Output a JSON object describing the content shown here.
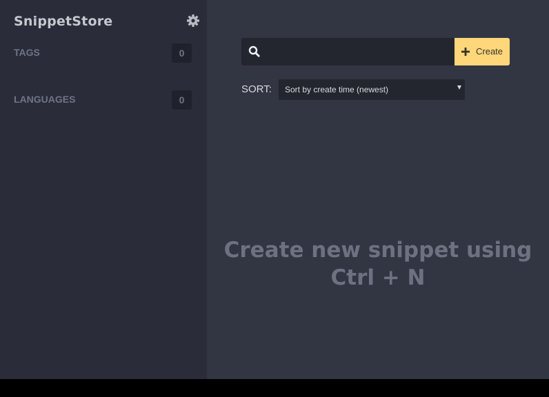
{
  "sidebar": {
    "app_title": "SnippetStore",
    "settings_icon": "gear-icon",
    "sections": [
      {
        "label": "TAGS",
        "count": "0"
      },
      {
        "label": "LANGUAGES",
        "count": "0"
      }
    ]
  },
  "main": {
    "search": {
      "icon": "search-icon",
      "value": "",
      "placeholder": ""
    },
    "create_button": {
      "icon": "plus-icon",
      "label": "Create"
    },
    "sort": {
      "label": "SORT:",
      "selected": "Sort by create time (newest)"
    },
    "empty_message": "Create new snippet using\nCtrl + N"
  },
  "colors": {
    "sidebar_bg": "#2a2d39",
    "main_bg": "#323542",
    "accent": "#fed77b"
  }
}
